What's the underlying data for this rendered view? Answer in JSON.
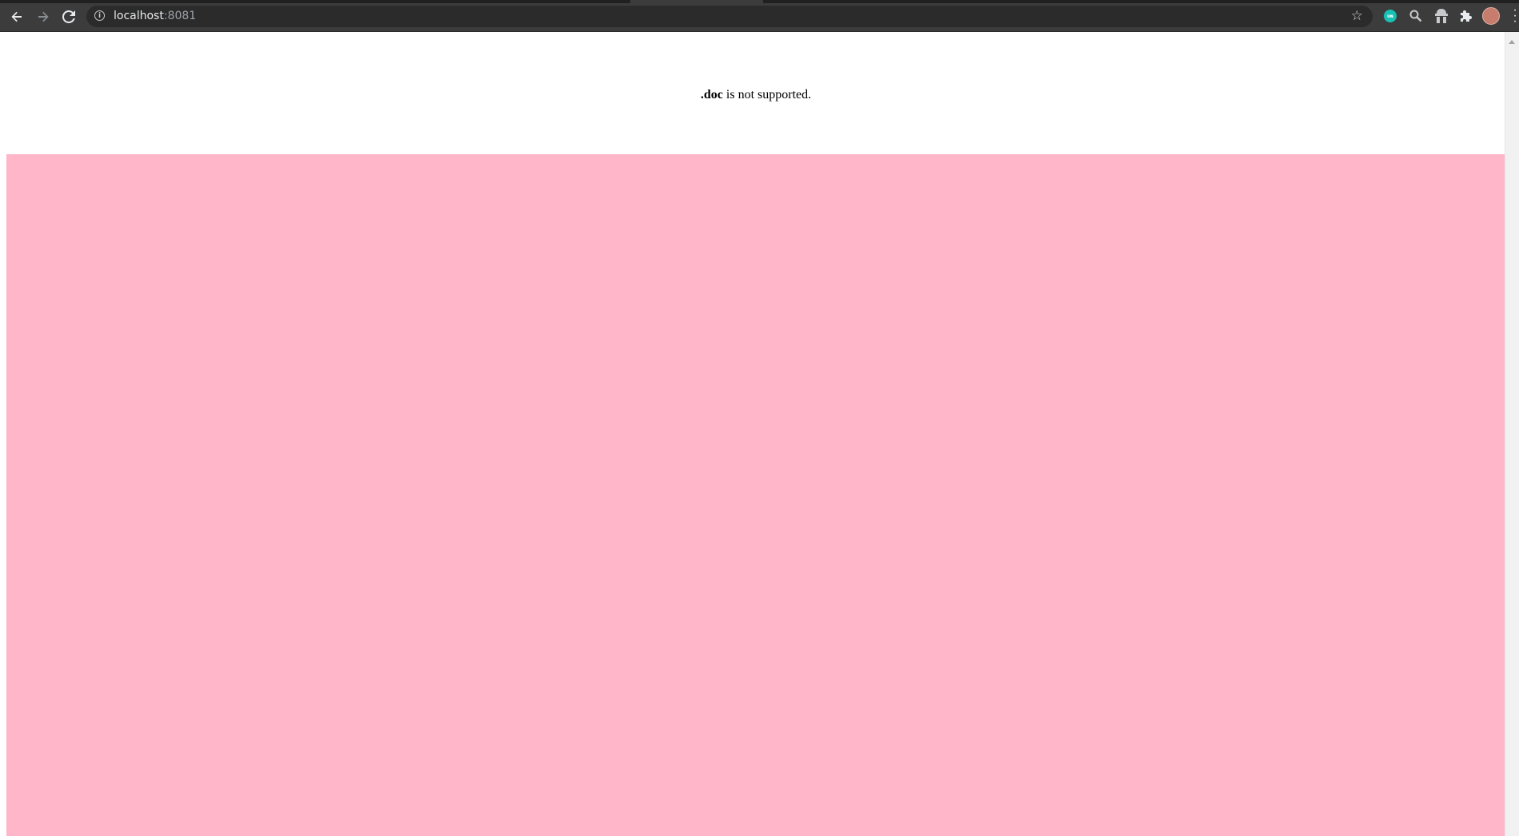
{
  "browser": {
    "url_host": "localhost",
    "url_port": ":8081",
    "icons": {
      "back": "back-arrow-icon",
      "forward": "forward-arrow-icon",
      "reload": "reload-icon",
      "info": "site-info-icon",
      "bookmark": "star-icon",
      "extension_teal": "extension-icon",
      "zoom": "search-icon",
      "extension_hat": "extension-icon",
      "puzzle": "puzzle-icon",
      "profile": "avatar",
      "menu": "more-vert-icon"
    },
    "extension_teal_text": "ᴜɴ"
  },
  "page": {
    "message_bold": ".doc",
    "message_rest": " is not supported.",
    "pink_panel_color": "#ffb6c8"
  }
}
